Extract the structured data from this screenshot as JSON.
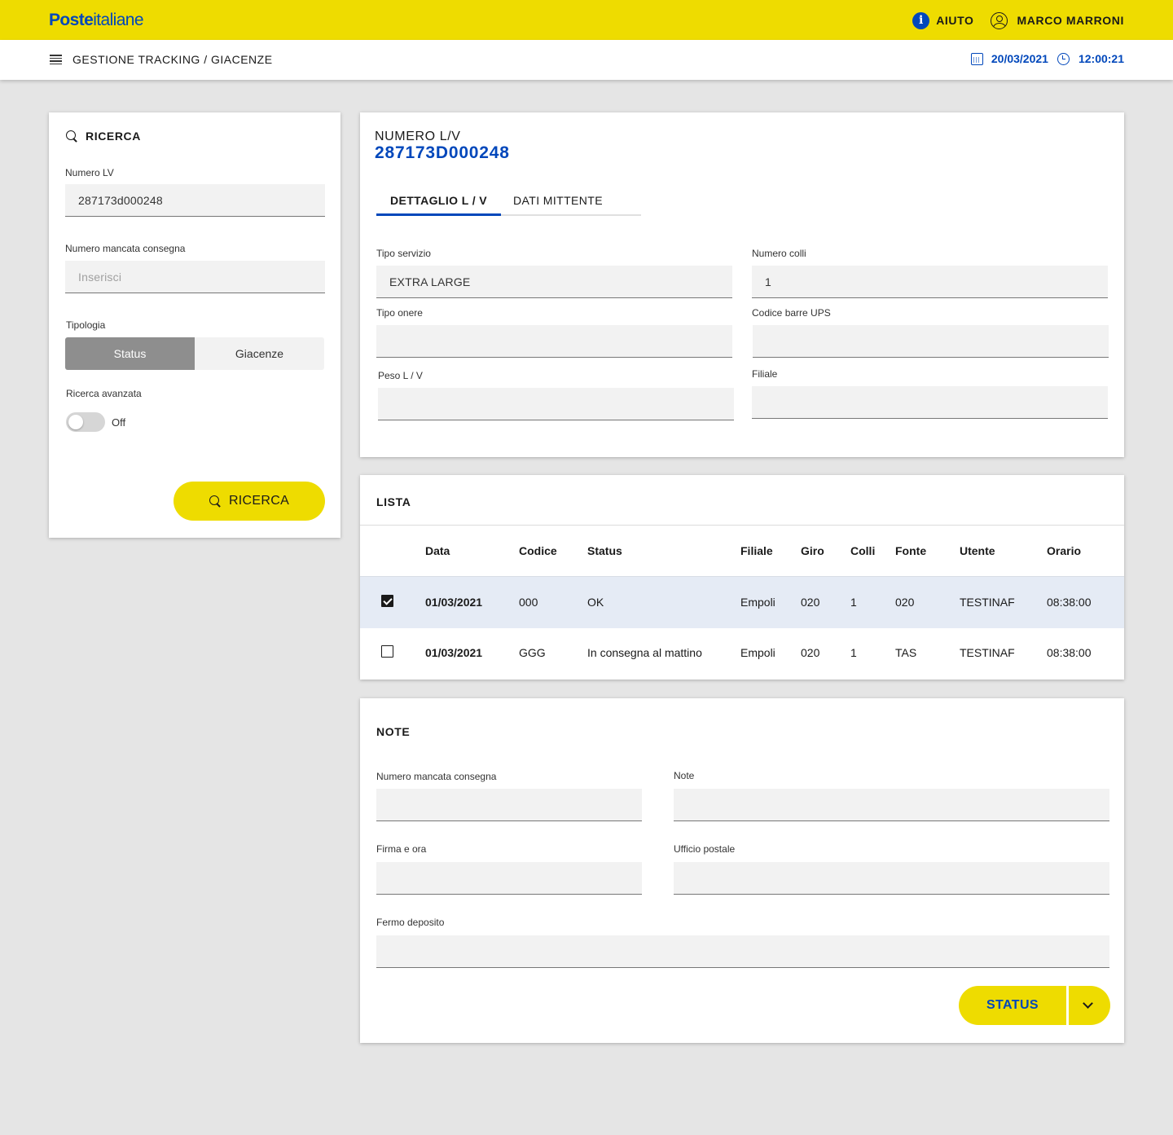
{
  "header": {
    "logo_bold": "Poste",
    "logo_light": "italiane",
    "help_label": "AIUTO",
    "user_name": "MARCO MARRONI"
  },
  "subheader": {
    "breadcrumb": "GESTIONE TRACKING / GIACENZE",
    "date": "20/03/2021",
    "time": "12:00:21"
  },
  "search": {
    "title": "RICERCA",
    "numero_lv_label": "Numero LV",
    "numero_lv_value": "287173d000248",
    "mancata_label": "Numero mancata consegna",
    "mancata_placeholder": "Inserisci",
    "tipologia_label": "Tipologia",
    "tipologia_options": [
      "Status",
      "Giacenze"
    ],
    "tipologia_selected": "Status",
    "advanced_label": "Ricerca avanzata",
    "advanced_state": "Off",
    "button_label": "RICERCA"
  },
  "detail": {
    "caption": "NUMERO L/V",
    "number": "287173D000248",
    "tabs": [
      "DETTAGLIO L / V",
      "DATI MITTENTE"
    ],
    "active_tab": "DETTAGLIO L / V",
    "fields": {
      "tipo_servizio": {
        "label": "Tipo servizio",
        "value": "EXTRA LARGE"
      },
      "numero_colli": {
        "label": "Numero colli",
        "value": "1"
      },
      "tipo_onere": {
        "label": "Tipo onere",
        "value": ""
      },
      "codice_barre": {
        "label": "Codice barre UPS",
        "value": ""
      },
      "peso": {
        "label": "Peso L / V",
        "value": ""
      },
      "filiale": {
        "label": "Filiale",
        "value": ""
      }
    }
  },
  "lista": {
    "title": "LISTA",
    "columns": [
      "Data",
      "Codice",
      "Status",
      "Filiale",
      "Giro",
      "Colli",
      "Fonte",
      "Utente",
      "Orario"
    ],
    "rows": [
      {
        "checked": true,
        "data": "01/03/2021",
        "codice": "000",
        "status": "OK",
        "filiale": "Empoli",
        "giro": "020",
        "colli": "1",
        "fonte": "020",
        "utente": "TESTINAF",
        "orario": "08:38:00"
      },
      {
        "checked": false,
        "data": "01/03/2021",
        "codice": "GGG",
        "status": "In consegna al mattino",
        "filiale": "Empoli",
        "giro": "020",
        "colli": "1",
        "fonte": "TAS",
        "utente": "TESTINAF",
        "orario": "08:38:00"
      }
    ]
  },
  "note": {
    "title": "NOTE",
    "mancata_label": "Numero mancata consegna",
    "note_label": "Note",
    "firma_label": "Firma e ora",
    "ufficio_label": "Ufficio postale",
    "fermo_label": "Fermo deposito",
    "status_button": "STATUS"
  },
  "colors": {
    "brand_yellow": "#eedc00",
    "brand_blue": "#0047bb",
    "selected_row": "#e5ebf5"
  }
}
